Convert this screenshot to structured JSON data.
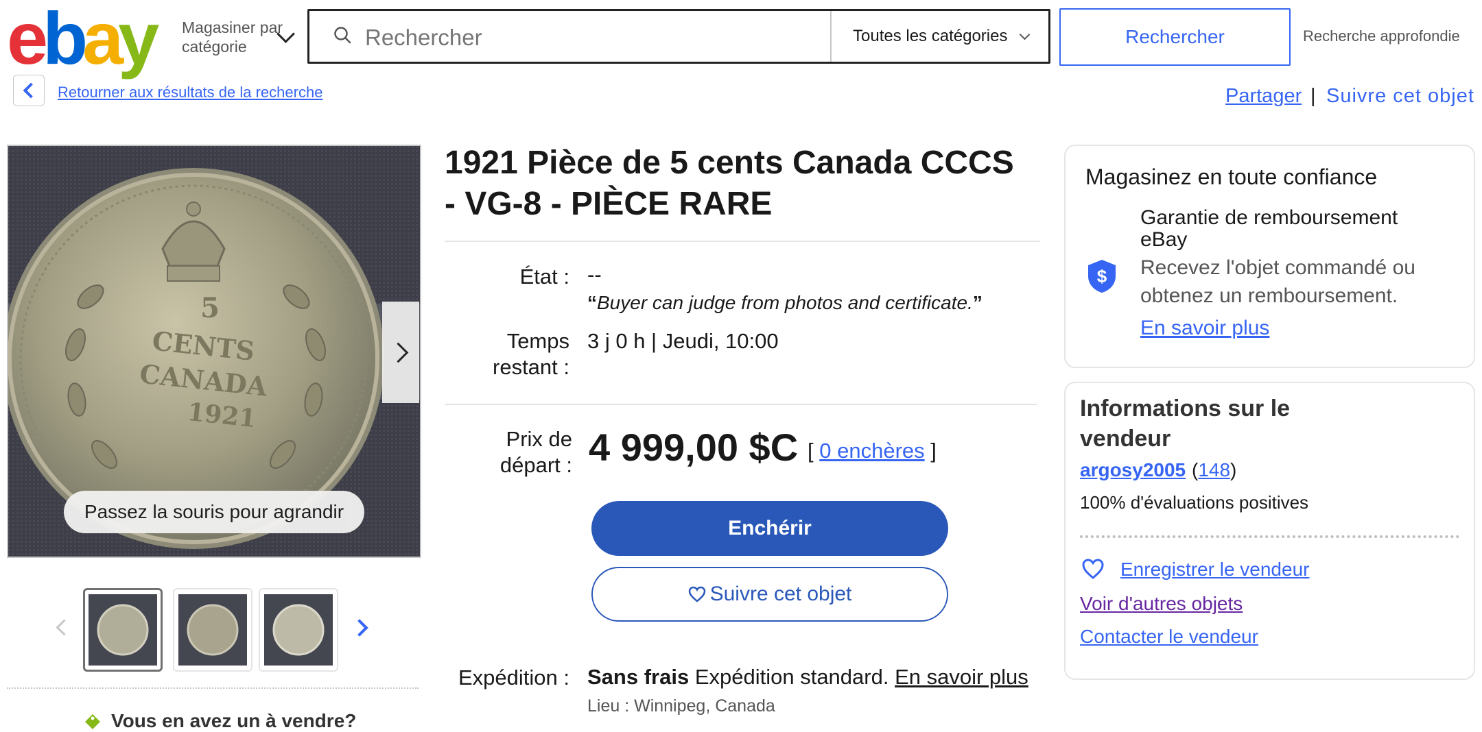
{
  "header": {
    "logo": [
      "e",
      "b",
      "a",
      "y"
    ],
    "logo_colors": [
      "#e53238",
      "#0064d2",
      "#f5af02",
      "#86b817"
    ],
    "shop_by_category": "Magasiner par catégorie",
    "search": {
      "placeholder": "Rechercher",
      "value": ""
    },
    "category_select": "Toutes les catégories",
    "search_button": "Rechercher",
    "advanced_search": "Recherche approfondie"
  },
  "nav": {
    "back_to_results": "Retourner aux résultats de la recherche",
    "share": "Partager",
    "separator": "|",
    "watch": "Suivre cet objet"
  },
  "gallery": {
    "zoom_hint": "Passez la souris pour agrandir",
    "coin_text": [
      "5",
      "CENTS",
      "CANADA",
      "1921"
    ],
    "thumbnail_count": 3,
    "selected_thumbnail": 1,
    "sell_prompt": "Vous en avez un à vendre?"
  },
  "item": {
    "title": "1921 Pièce de 5 cents Canada CCCS - VG-8 - PIÈCE RARE",
    "condition_label": "État :",
    "condition_value": "--",
    "condition_quote": "Buyer can judge from photos and certificate.",
    "time_left_label": "Temps restant :",
    "time_left_value": "3 j 0 h | Jeudi, 10:00",
    "start_price_label": "Prix de départ :",
    "price": "4 999,00 $C",
    "bids_open": "[",
    "bids": "0 enchères",
    "bids_close": "]",
    "bid_button": "Enchérir",
    "watch_button": "Suivre cet objet",
    "shipping_label": "Expédition :",
    "shipping_free": "Sans frais",
    "shipping_type": "Expédition standard.",
    "shipping_learn_more": "En savoir plus",
    "location": "Lieu : Winnipeg, Canada"
  },
  "confidence": {
    "title": "Magasinez en toute confiance",
    "guarantee_title": "Garantie de remboursement eBay",
    "guarantee_desc": "Recevez l'objet commandé ou obtenez un remboursement.",
    "learn_more": "En savoir plus"
  },
  "seller": {
    "title": "Informations sur le vendeur",
    "name": "argosy2005",
    "open_paren": "(",
    "feedback_count": "148",
    "close_paren": ")",
    "positive": "100% d'évaluations positives",
    "save_seller": "Enregistrer le vendeur",
    "other_items": "Voir d'autres objets",
    "contact": "Contacter le vendeur"
  },
  "colors": {
    "link": "#3665f3",
    "primary_button": "#2a58b8",
    "visited_link": "#6626a1"
  }
}
